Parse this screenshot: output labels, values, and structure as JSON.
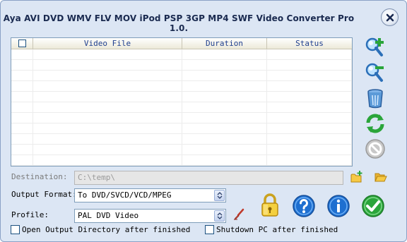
{
  "window": {
    "title": "Aya AVI DVD WMV FLV MOV iPod PSP 3GP MP4 SWF Video Converter Pro 1.0."
  },
  "file_list": {
    "columns": [
      "",
      "Video File",
      "Duration",
      "Status"
    ],
    "rows": []
  },
  "side_toolbar": {
    "icons": [
      "add-file-icon",
      "remove-file-icon",
      "clear-list-icon",
      "refresh-icon",
      "stop-icon"
    ]
  },
  "destination": {
    "label": "Destination:",
    "value": "C:\\temp\\",
    "icons": [
      "new-folder-icon",
      "open-folder-icon"
    ]
  },
  "output_format": {
    "label": "Output Format:",
    "value": "To DVD/SVCD/VCD/MPEG"
  },
  "profile": {
    "label": "Profile:",
    "value": "PAL DVD Video",
    "edit_icon": "edit-brush-icon"
  },
  "options": {
    "open_output_dir": "Open Output Directory after finished",
    "shutdown_pc": "Shutdown PC after finished"
  },
  "bottom_buttons": {
    "icons": [
      "lock-icon",
      "help-icon",
      "info-icon",
      "convert-check-icon"
    ]
  },
  "colors": {
    "background": "#dce6f4",
    "header_text": "#1f3f8f",
    "accent_green": "#2aa53a",
    "accent_blue": "#1e6fd0"
  }
}
